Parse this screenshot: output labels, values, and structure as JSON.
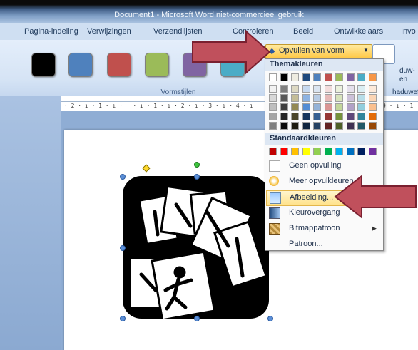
{
  "window": {
    "title": "Document1 - Microsoft Word niet-commercieel gebruik"
  },
  "tabs": [
    {
      "label": "Pagina-indeling"
    },
    {
      "label": "Verwijzingen"
    },
    {
      "label": "Verzendlijsten"
    },
    {
      "label": "Controleren"
    },
    {
      "label": "Beeld"
    },
    {
      "label": "Ontwikkelaars"
    },
    {
      "label": "Invo"
    }
  ],
  "ribbon": {
    "group_label": "Vormstijlen",
    "style_swatches": [
      "#000000",
      "#4f81bd",
      "#c0504d",
      "#9bbb59",
      "#8064a2",
      "#4bacc6"
    ],
    "fill_button_label": "Opvullen van vorm",
    "right_labels": [
      "duw-",
      "en",
      "haduwef"
    ]
  },
  "ruler": {
    "text": "· 2 · ı · 1 · ı ·   · ı · 1 · ı · 2 · ı · 3 · ı · 4 · ı",
    "right_text": "9 · ı · 1"
  },
  "fill_menu": {
    "theme_header": "Themakleuren",
    "theme_top_row": [
      "#ffffff",
      "#000000",
      "#eeece1",
      "#1f497d",
      "#4f81bd",
      "#c0504d",
      "#9bbb59",
      "#8064a2",
      "#4bacc6",
      "#f79646"
    ],
    "theme_shade_rows": [
      [
        "#f2f2f2",
        "#7f7f7f",
        "#ddd9c3",
        "#c6d9f0",
        "#dbe5f1",
        "#f2dcdb",
        "#ebf1dd",
        "#e5e0ec",
        "#dbeef3",
        "#fdeada"
      ],
      [
        "#d8d8d8",
        "#595959",
        "#c4bd97",
        "#8db3e2",
        "#b8cce4",
        "#e5b9b7",
        "#d7e3bc",
        "#ccc1d9",
        "#b7dde8",
        "#fbd5b5"
      ],
      [
        "#bfbfbf",
        "#3f3f3f",
        "#938953",
        "#548dd4",
        "#95b3d7",
        "#d99694",
        "#c3d69b",
        "#b2a2c7",
        "#92cddc",
        "#fac08f"
      ],
      [
        "#a5a5a5",
        "#262626",
        "#494429",
        "#17365d",
        "#366092",
        "#953734",
        "#76923c",
        "#5f497a",
        "#31859b",
        "#e36c09"
      ],
      [
        "#7f7f7f",
        "#0c0c0c",
        "#1d1b10",
        "#0f243e",
        "#244061",
        "#632423",
        "#4f6128",
        "#3f3151",
        "#205867",
        "#974806"
      ]
    ],
    "standard_header": "Standaardkleuren",
    "standard_colors": [
      "#c00000",
      "#ff0000",
      "#ffc000",
      "#ffff00",
      "#92d050",
      "#00b050",
      "#00b0f0",
      "#0070c0",
      "#002060",
      "#7030a0"
    ],
    "items": [
      {
        "label": "Geen opvulling",
        "icon": "no-fill-icon"
      },
      {
        "label": "Meer opvulkleuren...",
        "icon": "palette-icon"
      },
      {
        "label": "Afbeelding...",
        "icon": "picture-icon"
      },
      {
        "label": "Kleurovergang",
        "icon": "gradient-icon"
      },
      {
        "label": "Bitmappatroon",
        "icon": "texture-icon"
      },
      {
        "label": "Patroon...",
        "icon": "pattern-icon"
      }
    ]
  },
  "colors": {
    "arrow_fill": "#c0505c",
    "menu_highlight": "#ffe28a"
  }
}
